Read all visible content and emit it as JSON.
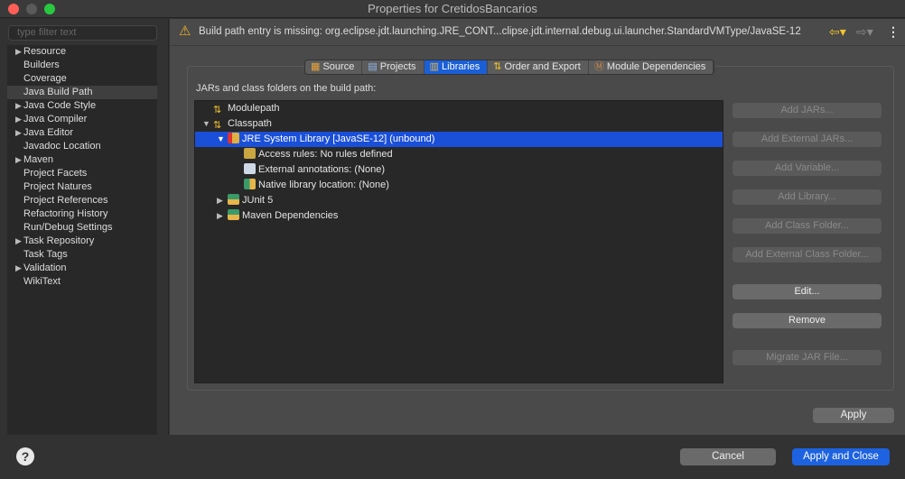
{
  "window": {
    "title": "Properties for CretidosBancarios"
  },
  "sidebar": {
    "filter_placeholder": "type filter text",
    "items": [
      {
        "label": "Resource",
        "expandable": true
      },
      {
        "label": "Builders"
      },
      {
        "label": "Coverage"
      },
      {
        "label": "Java Build Path",
        "selected": true
      },
      {
        "label": "Java Code Style",
        "expandable": true
      },
      {
        "label": "Java Compiler",
        "expandable": true
      },
      {
        "label": "Java Editor",
        "expandable": true
      },
      {
        "label": "Javadoc Location"
      },
      {
        "label": "Maven",
        "expandable": true
      },
      {
        "label": "Project Facets"
      },
      {
        "label": "Project Natures"
      },
      {
        "label": "Project References"
      },
      {
        "label": "Refactoring History"
      },
      {
        "label": "Run/Debug Settings"
      },
      {
        "label": "Task Repository",
        "expandable": true
      },
      {
        "label": "Task Tags"
      },
      {
        "label": "Validation",
        "expandable": true
      },
      {
        "label": "WikiText"
      }
    ]
  },
  "warning": {
    "message": "Build path entry is missing: org.eclipse.jdt.launching.JRE_CONT...clipse.jdt.internal.debug.ui.launcher.StandardVMType/JavaSE-12"
  },
  "tabs": [
    {
      "label": "Source"
    },
    {
      "label": "Projects"
    },
    {
      "label": "Libraries",
      "selected": true
    },
    {
      "label": "Order and Export"
    },
    {
      "label": "Module Dependencies"
    }
  ],
  "build_path": {
    "caption": "JARs and class folders on the build path:",
    "tree": [
      {
        "label": "Modulepath",
        "depth": 0
      },
      {
        "label": "Classpath",
        "depth": 0,
        "expanded": true
      },
      {
        "label": "JRE System Library [JavaSE-12] (unbound)",
        "depth": 1,
        "expanded": true,
        "selected": true
      },
      {
        "label": "Access rules: No rules defined",
        "depth": 2
      },
      {
        "label": "External annotations: (None)",
        "depth": 2
      },
      {
        "label": "Native library location: (None)",
        "depth": 2
      },
      {
        "label": "JUnit 5",
        "depth": 1,
        "expanded": false
      },
      {
        "label": "Maven Dependencies",
        "depth": 1,
        "expanded": false
      }
    ]
  },
  "buttons": {
    "add_jars": "Add JARs...",
    "add_external_jars": "Add External JARs...",
    "add_variable": "Add Variable...",
    "add_library": "Add Library...",
    "add_class_folder": "Add Class Folder...",
    "add_external_class_folder": "Add External Class Folder...",
    "edit": "Edit...",
    "remove": "Remove",
    "migrate_jar": "Migrate JAR File...",
    "apply": "Apply",
    "cancel": "Cancel",
    "apply_close": "Apply and Close"
  }
}
